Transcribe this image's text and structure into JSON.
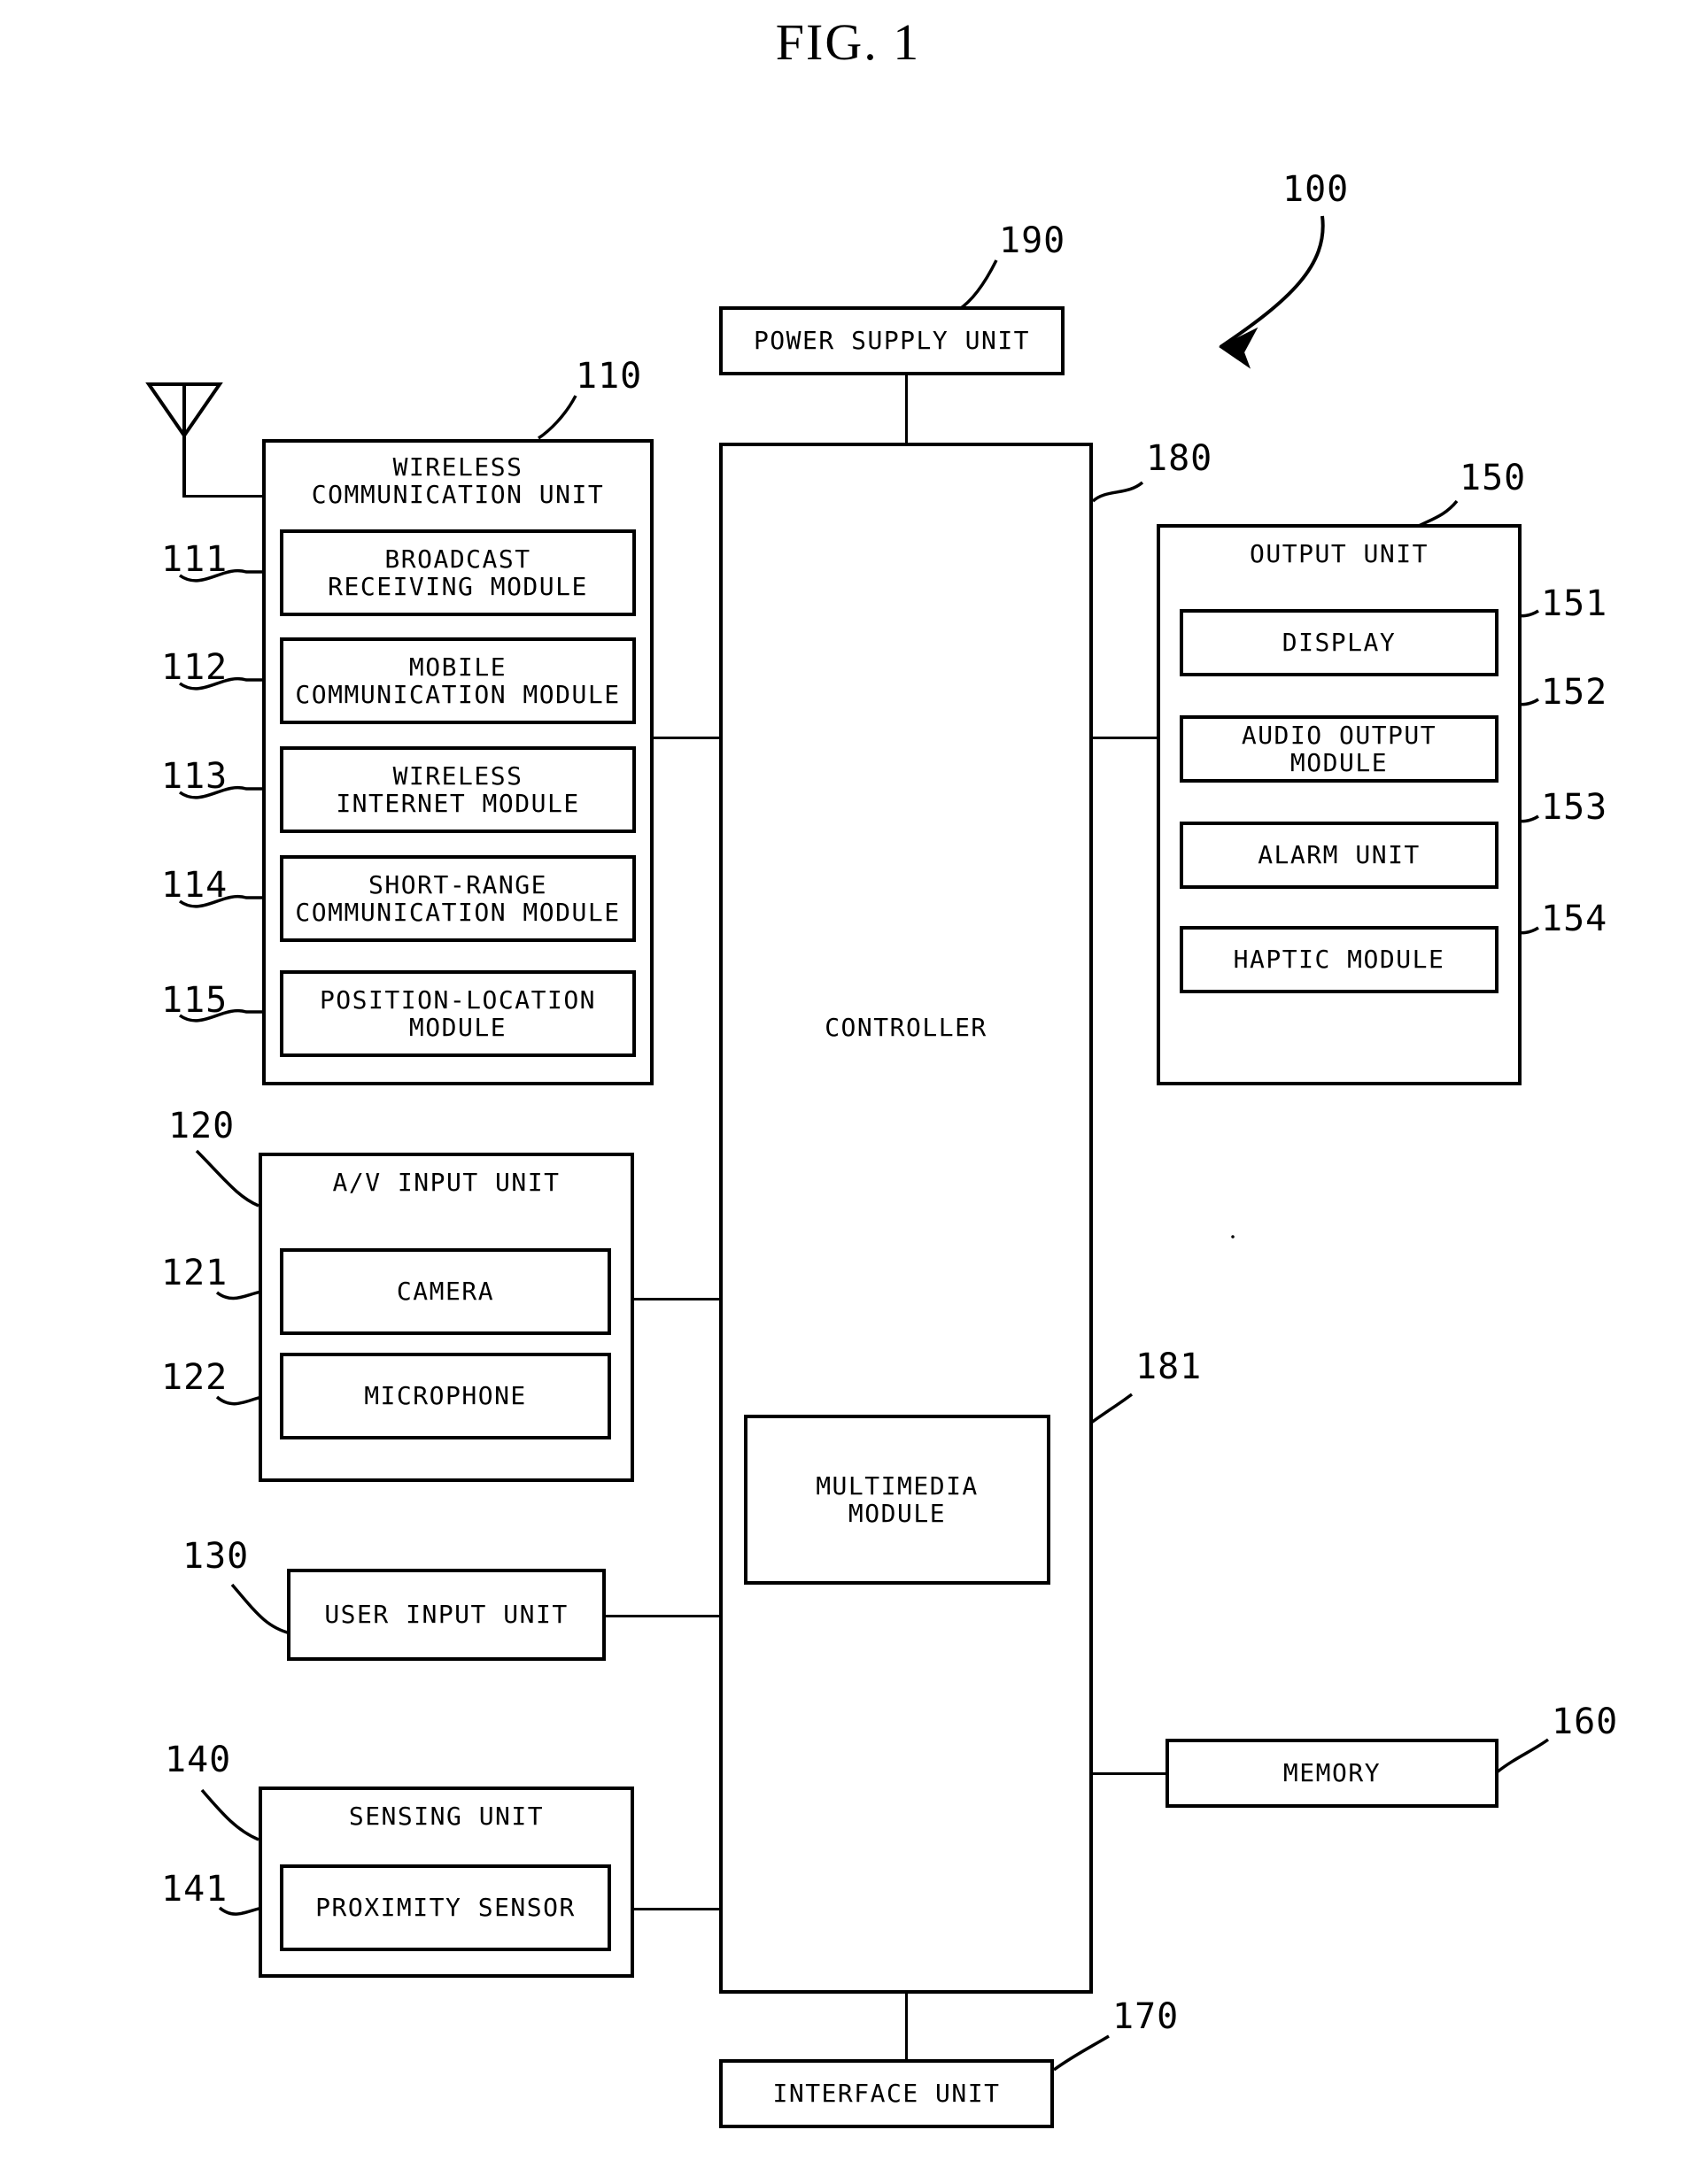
{
  "figure": {
    "title": "FIG. 1",
    "system_ref": "100"
  },
  "blocks": {
    "power_supply": {
      "label": "POWER SUPPLY UNIT",
      "ref": "190"
    },
    "wireless_unit": {
      "label": "WIRELESS\nCOMMUNICATION UNIT",
      "ref": "110",
      "modules": [
        {
          "label": "BROADCAST\nRECEIVING MODULE",
          "ref": "111"
        },
        {
          "label": "MOBILE\nCOMMUNICATION MODULE",
          "ref": "112"
        },
        {
          "label": "WIRELESS\nINTERNET MODULE",
          "ref": "113"
        },
        {
          "label": "SHORT-RANGE\nCOMMUNICATION MODULE",
          "ref": "114"
        },
        {
          "label": "POSITION-LOCATION\nMODULE",
          "ref": "115"
        }
      ]
    },
    "av_input_unit": {
      "label": "A/V INPUT UNIT",
      "ref": "120",
      "modules": [
        {
          "label": "CAMERA",
          "ref": "121"
        },
        {
          "label": "MICROPHONE",
          "ref": "122"
        }
      ]
    },
    "user_input_unit": {
      "label": "USER INPUT UNIT",
      "ref": "130"
    },
    "sensing_unit": {
      "label": "SENSING UNIT",
      "ref": "140",
      "modules": [
        {
          "label": "PROXIMITY SENSOR",
          "ref": "141"
        }
      ]
    },
    "controller": {
      "label": "CONTROLLER",
      "ref": "180"
    },
    "multimedia_module": {
      "label": "MULTIMEDIA\nMODULE",
      "ref": "181"
    },
    "output_unit": {
      "label": "OUTPUT UNIT",
      "ref": "150",
      "modules": [
        {
          "label": "DISPLAY",
          "ref": "151"
        },
        {
          "label": "AUDIO OUTPUT MODULE",
          "ref": "152"
        },
        {
          "label": "ALARM UNIT",
          "ref": "153"
        },
        {
          "label": "HAPTIC MODULE",
          "ref": "154"
        }
      ]
    },
    "memory": {
      "label": "MEMORY",
      "ref": "160"
    },
    "interface_unit": {
      "label": "INTERFACE UNIT",
      "ref": "170"
    }
  },
  "icons": {
    "antenna": "antenna-icon",
    "system_arrow": "curved-arrow-icon"
  },
  "colors": {
    "stroke": "#000000",
    "background": "#ffffff"
  }
}
